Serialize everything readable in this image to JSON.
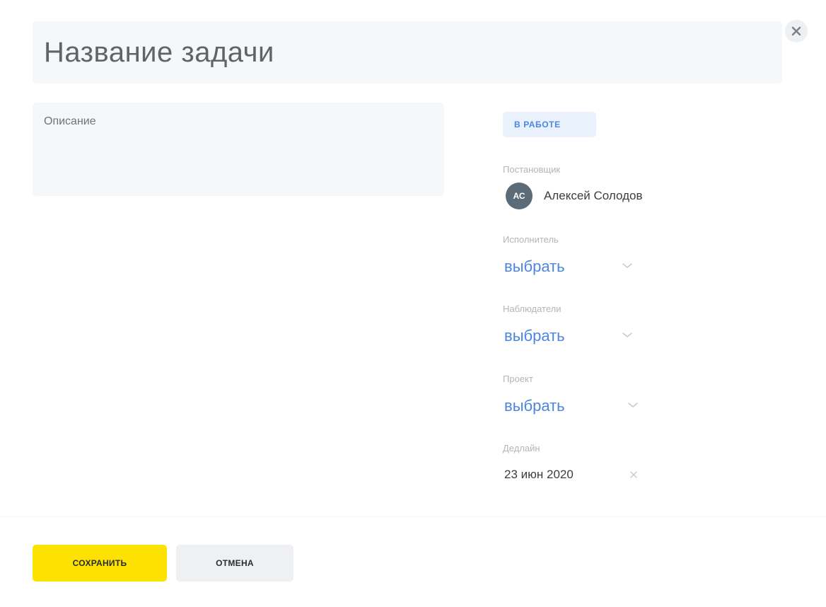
{
  "task": {
    "title_placeholder": "Название задачи",
    "description_placeholder": "Описание"
  },
  "status": {
    "label": "В РАБОТЕ",
    "color": "#4b86e0",
    "background": "#e9f1fd"
  },
  "fields": {
    "author": {
      "label": "Постановщик",
      "initials": "АС",
      "name": "Алексей Солодов"
    },
    "assignee": {
      "label": "Исполнитель",
      "value": "выбрать"
    },
    "watchers": {
      "label": "Наблюдатели",
      "value": "выбрать"
    },
    "project": {
      "label": "Проект",
      "value": "выбрать"
    },
    "deadline": {
      "label": "Дедлайн",
      "value": "23 июн 2020"
    }
  },
  "actions": {
    "save_label": "СОХРАНИТЬ",
    "cancel_label": "ОТМЕНА"
  },
  "icons": {
    "close": "close-icon",
    "chevron": "chevron-down-icon",
    "clear": "clear-icon"
  },
  "colors": {
    "accent_blue": "#4b86e0",
    "save_yellow": "#fde100",
    "field_bg": "#f5f7f9"
  }
}
